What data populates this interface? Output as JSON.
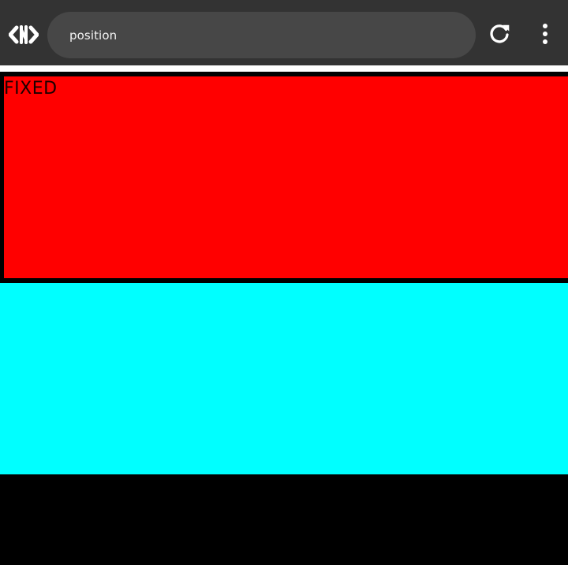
{
  "browser": {
    "address_bar": {
      "value": "position"
    },
    "icons": {
      "logo": "code-brackets-logo-icon",
      "refresh": "refresh-icon",
      "menu": "vertical-dots-menu-icon"
    },
    "colors": {
      "toolbar": "#333333",
      "address_bar": "#474747",
      "address_text": "#f2f2f2",
      "icon": "#ffffff"
    }
  },
  "page": {
    "fixed_box": {
      "label": "FIXED",
      "background": "#ff0000",
      "border": "#000000"
    },
    "cyan_box": {
      "background": "#00ffff"
    },
    "background": "#000000",
    "top_strip": "#ffffff"
  }
}
